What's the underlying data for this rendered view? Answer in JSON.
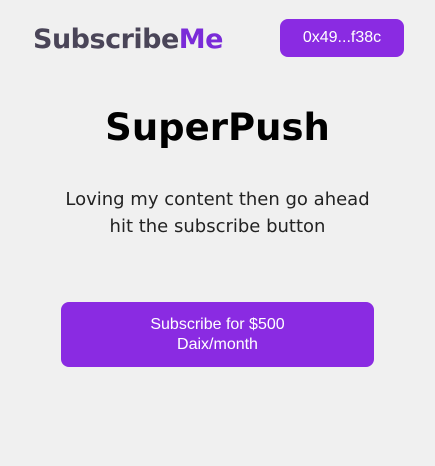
{
  "header": {
    "logo_part1": "Subscribe",
    "logo_part2": "Me",
    "wallet_label": "0x49...f38c"
  },
  "main": {
    "title": "SuperPush",
    "description": "Loving my content then go ahead hit the subscribe button",
    "subscribe_label": "Subscribe for $500 Daix/month"
  },
  "colors": {
    "accent": "#8a2be2",
    "logo_dark": "#4a4558",
    "logo_accent": "#7a2bd8",
    "background": "#f0f0f0"
  }
}
